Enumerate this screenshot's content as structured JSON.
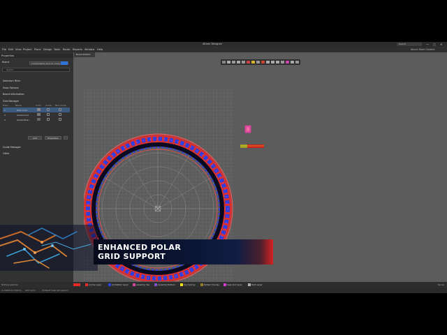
{
  "app": {
    "title": "Altium Designer",
    "search_placeholder": "Search",
    "window_controls": [
      "—",
      "□",
      "✕"
    ]
  },
  "menu": {
    "items": [
      "File",
      "Edit",
      "View",
      "Project",
      "Place",
      "Design",
      "Tools",
      "Route",
      "Reports",
      "Window",
      "Help"
    ],
    "right_label": "Altium Team Content"
  },
  "properties_panel": {
    "title": "Properties",
    "section_label": "Board",
    "combo_value": "Components (and 11 more)",
    "search_placeholder": "Search",
    "sections": [
      "Selection Filter",
      "Snap Options",
      "Board Information",
      "Grid Manager",
      "Guide Manager",
      "Other"
    ],
    "grid_table": {
      "headers": [
        "Prior...",
        "Name",
        "Color",
        "Comp",
        "Non Comp"
      ],
      "rows": [
        {
          "priority": "1",
          "name": "Polar Grid",
          "selected": true
        },
        {
          "priority": "2",
          "name": "Global Grid",
          "selected": false
        },
        {
          "priority": "3",
          "name": "Global Boar...",
          "selected": false
        }
      ]
    },
    "add_button": "Add",
    "properties_button": "Properties"
  },
  "document_tab": {
    "label": "Board.PcbDoc"
  },
  "status_layers": [
    {
      "name": "[1] Top Layer",
      "color": "#e52b2b"
    },
    {
      "name": "[2] Bottom Layer",
      "color": "#2f3fe0"
    },
    {
      "name": "Assembly Top",
      "color": "#d24a9c"
    },
    {
      "name": "Assembly Bottom",
      "color": "#7a52c9"
    },
    {
      "name": "Top Overlay",
      "color": "#f4e11c"
    },
    {
      "name": "Bottom Overlay",
      "color": "#9a7a2a"
    },
    {
      "name": "Keep-Out Layer",
      "color": "#d13ad1"
    },
    {
      "name": "Multi-Layer",
      "color": "#b0b0b0"
    }
  ],
  "bottom_status": {
    "left": "Nothing selected",
    "coords": "X:-1450mm Y:95mm",
    "grid": "Grid: 1mm",
    "snap": "(Hotspot Snap (All Layers))",
    "right": "Panels"
  },
  "overlay": {
    "line1": "ENHANCED POLAR",
    "line2": "GRID SUPPORT"
  },
  "colors": {
    "canvas_bg": "#5c5c5c",
    "panel_bg": "#323232",
    "top_layer": "#e52b2b",
    "bottom_layer": "#2f3fe0",
    "banner_accent": "#d42121"
  }
}
